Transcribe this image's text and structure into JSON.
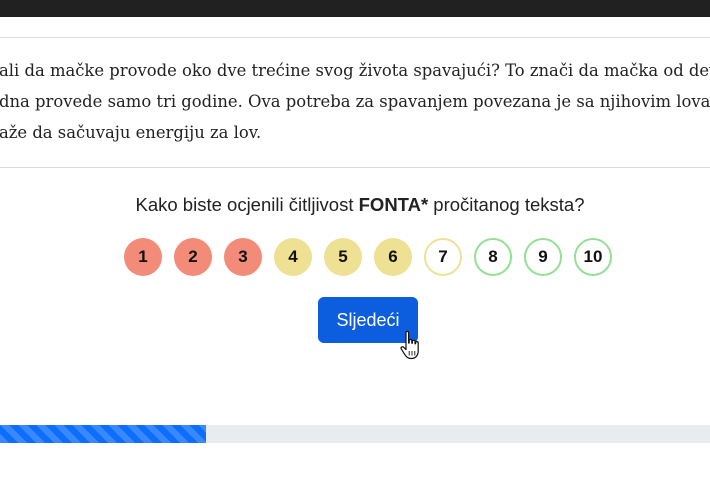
{
  "passage": {
    "lines": [
      "ali da mačke provode oko dve trećine svog života spavajući? To znači da mačka od devet",
      "dna provede samo tri godine. Ova potreba za spavanjem povezana je sa njihovim lovački",
      "aže da sačuvaju energiju za lov."
    ]
  },
  "question": {
    "before": "Kako biste ocjenili čitljivost ",
    "bold": "FONTA*",
    "after": " pročitanog teksta?"
  },
  "ratings": [
    {
      "label": "1",
      "style": "red"
    },
    {
      "label": "2",
      "style": "red"
    },
    {
      "label": "3",
      "style": "red"
    },
    {
      "label": "4",
      "style": "yellow"
    },
    {
      "label": "5",
      "style": "yellow"
    },
    {
      "label": "6",
      "style": "yellow"
    },
    {
      "label": "7",
      "style": "yellow-outline"
    },
    {
      "label": "8",
      "style": "green-outline"
    },
    {
      "label": "9",
      "style": "green-outline"
    },
    {
      "label": "10",
      "style": "green-outline"
    }
  ],
  "next_button": {
    "label": "Sljedeći"
  },
  "progress": {
    "fraction": 0.29
  },
  "colors": {
    "accent": "#0d5ede",
    "rating_red": "#f28b78",
    "rating_yellow": "#efe193",
    "rating_green": "#93e093",
    "topbar": "#212121"
  },
  "icons": {
    "cursor": "hand-pointer-icon"
  }
}
